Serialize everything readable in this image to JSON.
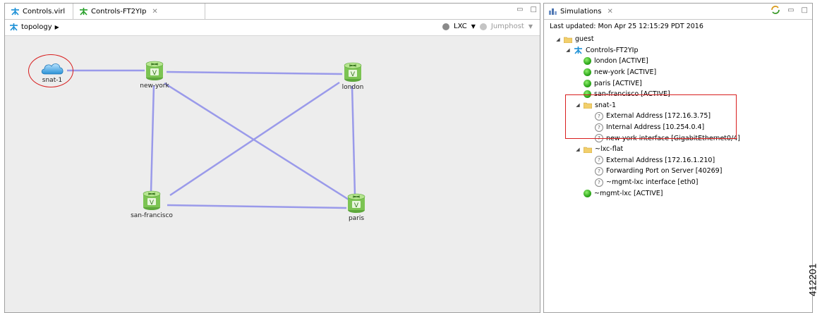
{
  "editor": {
    "tabs": [
      {
        "label": "Controls.virl",
        "active": false
      },
      {
        "label": "Controls-FT2YIp",
        "active": true
      }
    ],
    "breadcrumb": "topology",
    "toolbar": {
      "lxc_label": "LXC",
      "jumphost_label": "Jumphost"
    },
    "nodes": {
      "snat": "snat-1",
      "new_york": "new-york",
      "london": "london",
      "san_francisco": "san-francisco",
      "paris": "paris"
    }
  },
  "simulations": {
    "tab_label": "Simulations",
    "last_updated": "Last updated: Mon Apr 25 12:15:29 PDT 2016",
    "tree": {
      "guest": "guest",
      "sim": "Controls-FT2YIp",
      "london": "london  [ACTIVE]",
      "new_york": "new-york  [ACTIVE]",
      "paris": "paris  [ACTIVE]",
      "san_francisco": "san-francisco  [ACTIVE]",
      "snat": "snat-1",
      "snat_ext": "External Address  [172.16.3.75]",
      "snat_int": "Internal Address  [10.254.0.4]",
      "snat_if": "new-york interface  [GigabitEthernet0/4]",
      "lxc_flat": "~lxc-flat",
      "lxc_ext": "External Address  [172.16.1.210]",
      "lxc_fwd": "Forwarding Port on Server  [40269]",
      "lxc_if": "~mgmt-lxc interface  [eth0]",
      "mgmt": "~mgmt-lxc  [ACTIVE]"
    }
  },
  "figure_id": "412201",
  "colors": {
    "link": "#9a9aea",
    "highlight": "#d81e1e",
    "active": "#2fa81c"
  }
}
